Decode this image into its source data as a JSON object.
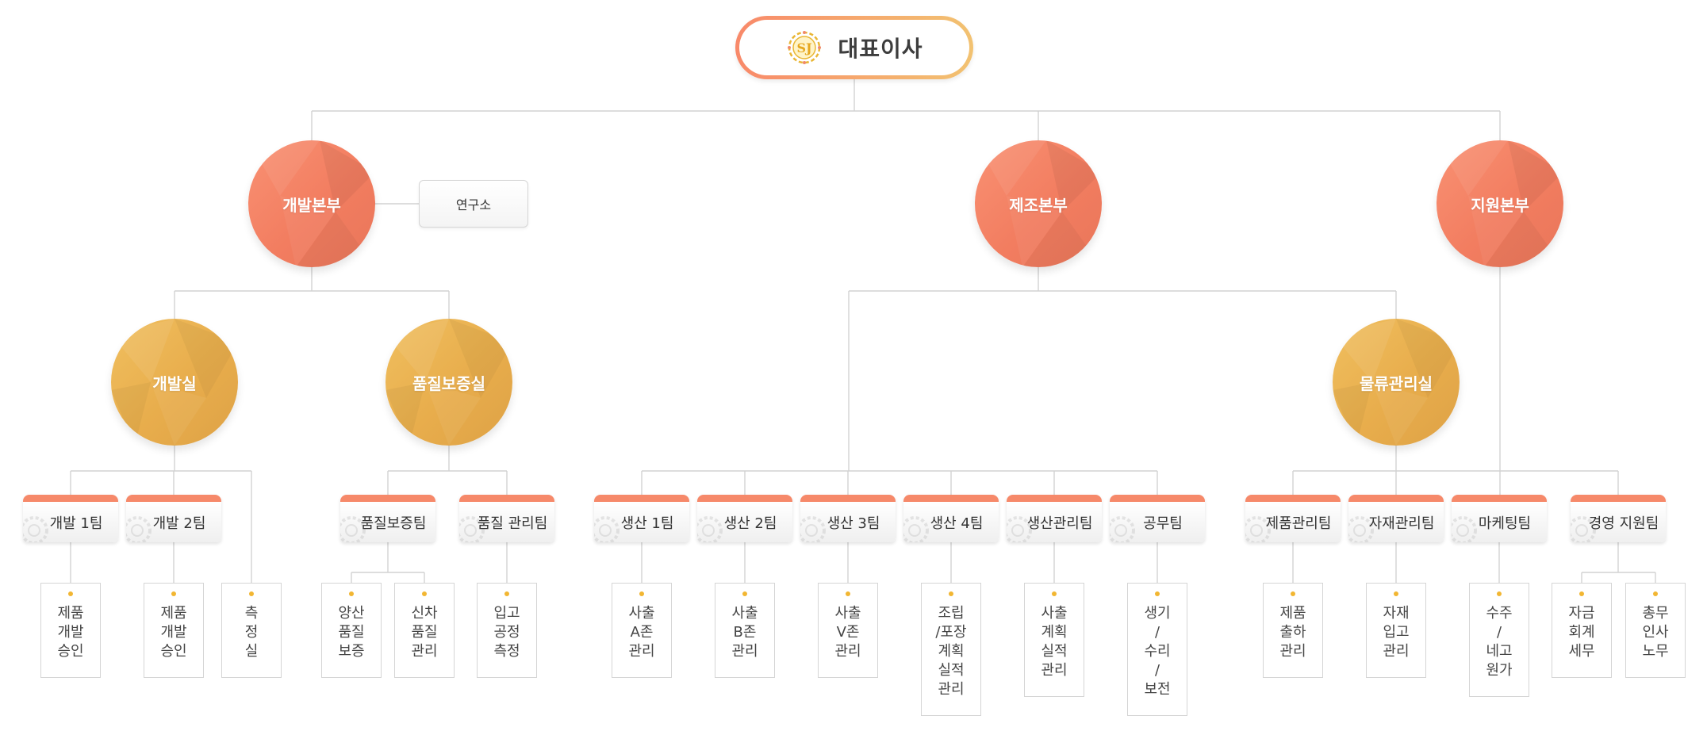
{
  "ceo": {
    "title": "대표이사",
    "logo_icon": "sj-gear-logo-icon"
  },
  "headquarters": [
    {
      "id": "dev-hq",
      "label": "개발본부"
    },
    {
      "id": "mfg-hq",
      "label": "제조본부"
    },
    {
      "id": "sup-hq",
      "label": "지원본부"
    }
  ],
  "lab": {
    "label": "연구소"
  },
  "rooms": [
    {
      "id": "dev-room",
      "label": "개발실"
    },
    {
      "id": "qa-room",
      "label": "품질보증실"
    },
    {
      "id": "logistics-room",
      "label": "물류관리실"
    }
  ],
  "teams": [
    {
      "id": "dev1",
      "label": "개발 1팀"
    },
    {
      "id": "dev2",
      "label": "개발 2팀"
    },
    {
      "id": "qa",
      "label": "품질보증팀"
    },
    {
      "id": "qm",
      "label": "품질 관리팀"
    },
    {
      "id": "prod1",
      "label": "생산 1팀"
    },
    {
      "id": "prod2",
      "label": "생산 2팀"
    },
    {
      "id": "prod3",
      "label": "생산 3팀"
    },
    {
      "id": "prod4",
      "label": "생산 4팀"
    },
    {
      "id": "prodmgmt",
      "label": "생산관리팀"
    },
    {
      "id": "works",
      "label": "공무팀"
    },
    {
      "id": "product",
      "label": "제품관리팀"
    },
    {
      "id": "material",
      "label": "자재관리팀"
    },
    {
      "id": "marketing",
      "label": "마케팅팀"
    },
    {
      "id": "mgmt",
      "label": "경영 지원팀"
    }
  ],
  "tasks": [
    {
      "id": "t1",
      "text": "제품\n개발\n승인"
    },
    {
      "id": "t2",
      "text": "제품\n개발\n승인"
    },
    {
      "id": "t3",
      "text": "측\n정\n실"
    },
    {
      "id": "t4",
      "text": "양산\n품질\n보증"
    },
    {
      "id": "t5",
      "text": "신차\n품질\n관리"
    },
    {
      "id": "t6",
      "text": "입고\n공정\n측정"
    },
    {
      "id": "t7",
      "text": "사출\nA존\n관리"
    },
    {
      "id": "t8",
      "text": "사출\nB존\n관리"
    },
    {
      "id": "t9",
      "text": "사출\nV존\n관리"
    },
    {
      "id": "t10",
      "text": "조립\n/포장\n계획\n실적\n관리"
    },
    {
      "id": "t11",
      "text": "사출\n계획\n실적\n관리"
    },
    {
      "id": "t12",
      "text": "생기\n/\n수리\n/\n보전"
    },
    {
      "id": "t13",
      "text": "제품\n출하\n관리"
    },
    {
      "id": "t14",
      "text": "자재\n입고\n관리"
    },
    {
      "id": "t15",
      "text": "수주\n/\n네고\n원가"
    },
    {
      "id": "t16",
      "text": "자금\n회계\n세무"
    },
    {
      "id": "t17",
      "text": "총무\n인사\n노무"
    }
  ],
  "colors": {
    "hq": "#f27d60",
    "room": "#e8ad4c",
    "team_accent": "#f6896a",
    "task_dot": "#f2b632",
    "connector": "#d2d2d2"
  },
  "icons": {
    "team_decoration": "gear-icon"
  }
}
